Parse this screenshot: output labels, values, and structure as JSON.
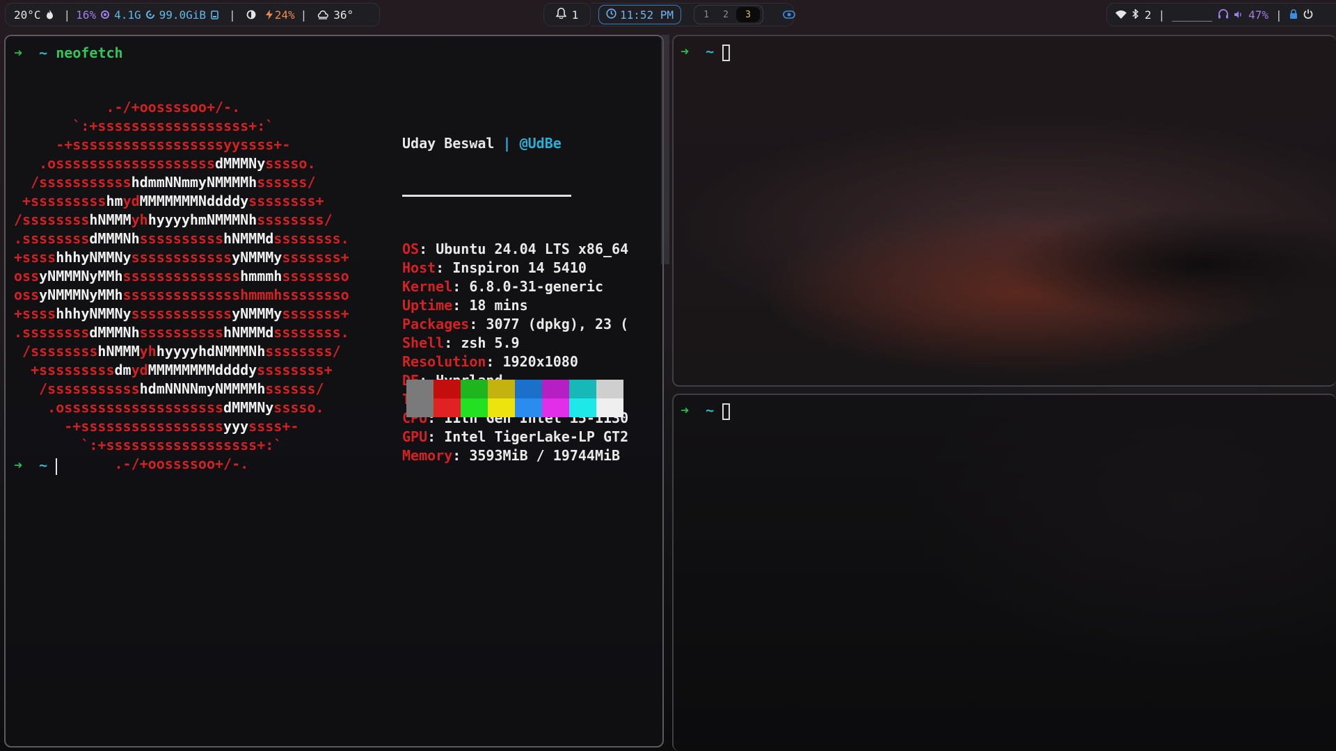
{
  "topbar": {
    "temperature": "20°C",
    "cpu": "16%",
    "memory": "4.1G",
    "disk": "99.0GiB",
    "brightness": "24%",
    "weather_temp": "36°",
    "notifications": "1",
    "clock": "11:52 PM",
    "workspaces": [
      "1",
      "2",
      "3"
    ],
    "active_workspace": "3",
    "bluetooth_count": "2",
    "media": "______",
    "volume": "47%"
  },
  "left_terminal": {
    "prompt_arrow": "➜",
    "prompt_dir": "~",
    "command": "neofetch",
    "logo_lines": [
      [
        [
          "r",
          "           .-/+oossssoo+/-."
        ]
      ],
      [
        [
          "r",
          "       `:+ssssssssssssssssss+:`"
        ]
      ],
      [
        [
          "r",
          "     -+ssssssssssssssssssyyssss+-"
        ]
      ],
      [
        [
          "r",
          "   .osssssssssssssssssss"
        ],
        [
          "w",
          "dMMMNy"
        ],
        [
          "r",
          "sssso."
        ]
      ],
      [
        [
          "r",
          "  /sssssssssss"
        ],
        [
          "w",
          "hdmmNNmmyNMMMMh"
        ],
        [
          "r",
          "ssssss/"
        ]
      ],
      [
        [
          "r",
          " +sssssssss"
        ],
        [
          "w",
          "hm"
        ],
        [
          "r",
          "yd"
        ],
        [
          "w",
          "MMMMMMMNddddy"
        ],
        [
          "r",
          "ssssssss+"
        ]
      ],
      [
        [
          "r",
          "/ssssssss"
        ],
        [
          "w",
          "hNMMM"
        ],
        [
          "r",
          "yh"
        ],
        [
          "w",
          "hyyyyhmNMMMNh"
        ],
        [
          "r",
          "ssssssss/"
        ]
      ],
      [
        [
          "r",
          ".ssssssss"
        ],
        [
          "w",
          "dMMMNh"
        ],
        [
          "r",
          "ssssssssss"
        ],
        [
          "w",
          "hNMMMd"
        ],
        [
          "r",
          "ssssssss."
        ]
      ],
      [
        [
          "r",
          "+ssss"
        ],
        [
          "w",
          "hhhyNMMNy"
        ],
        [
          "r",
          "ssssssssssss"
        ],
        [
          "w",
          "yNMMMy"
        ],
        [
          "r",
          "sssssss+"
        ]
      ],
      [
        [
          "r",
          "oss"
        ],
        [
          "w",
          "yNMMMNyMMh"
        ],
        [
          "r",
          "ssssssssssssss"
        ],
        [
          "w",
          "hmmmh"
        ],
        [
          "r",
          "ssssssso"
        ]
      ],
      [
        [
          "r",
          "oss"
        ],
        [
          "w",
          "yNMMMNyMMh"
        ],
        [
          "r",
          "sssssssssssssshmmmhssssssso"
        ]
      ],
      [
        [
          "r",
          "+ssss"
        ],
        [
          "w",
          "hhhyNMMNy"
        ],
        [
          "r",
          "ssssssssssss"
        ],
        [
          "w",
          "yNMMMy"
        ],
        [
          "r",
          "sssssss+"
        ]
      ],
      [
        [
          "r",
          ".ssssssss"
        ],
        [
          "w",
          "dMMMNh"
        ],
        [
          "r",
          "ssssssssss"
        ],
        [
          "w",
          "hNMMMd"
        ],
        [
          "r",
          "ssssssss."
        ]
      ],
      [
        [
          "r",
          " /ssssssss"
        ],
        [
          "w",
          "hNMMM"
        ],
        [
          "r",
          "yh"
        ],
        [
          "w",
          "hyyyyhdNMMMNh"
        ],
        [
          "r",
          "ssssssss/"
        ]
      ],
      [
        [
          "r",
          "  +sssssssss"
        ],
        [
          "w",
          "dm"
        ],
        [
          "r",
          "yd"
        ],
        [
          "w",
          "MMMMMMMMddddy"
        ],
        [
          "r",
          "ssssssss+"
        ]
      ],
      [
        [
          "r",
          "   /sssssssssss"
        ],
        [
          "w",
          "hdmNNNNmyNMMMMh"
        ],
        [
          "r",
          "ssssss/"
        ]
      ],
      [
        [
          "r",
          "    .osssssssssssssssssss"
        ],
        [
          "w",
          "dMMMNy"
        ],
        [
          "r",
          "sssso."
        ]
      ],
      [
        [
          "r",
          "      -+sssssssssssssssss"
        ],
        [
          "w",
          "yyy"
        ],
        [
          "r",
          "ssss+-"
        ]
      ],
      [
        [
          "r",
          "        `:+ssssssssssssssssss+:`"
        ]
      ],
      [
        [
          "r",
          "            .-/+oossssoo+/-."
        ]
      ]
    ],
    "user": "Uday Beswal",
    "separator": "|",
    "handle": "@UdBe",
    "info": [
      {
        "key": "OS",
        "value": "Ubuntu 24.04 LTS x86_64"
      },
      {
        "key": "Host",
        "value": "Inspiron 14 5410"
      },
      {
        "key": "Kernel",
        "value": "6.8.0-31-generic"
      },
      {
        "key": "Uptime",
        "value": "18 mins"
      },
      {
        "key": "Packages",
        "value": "3077 (dpkg), 23 ("
      },
      {
        "key": "Shell",
        "value": "zsh 5.9"
      },
      {
        "key": "Resolution",
        "value": "1920x1080"
      },
      {
        "key": "DE",
        "value": "Hyprland"
      },
      {
        "key": "Terminal",
        "value": "kitty"
      },
      {
        "key": "CPU",
        "value": "11th Gen Intel i5-1130"
      },
      {
        "key": "GPU",
        "value": "Intel TigerLake-LP GT2"
      },
      {
        "key": "Memory",
        "value": "3593MiB / 19744MiB"
      }
    ],
    "palette_top": [
      "#7a7a7a",
      "#c40e0e",
      "#1fb51f",
      "#c4b30e",
      "#1b70c9",
      "#b51fc4",
      "#16b8b8",
      "#cfcfcf"
    ],
    "palette_bottom": [
      "#7a7a7a",
      "#e02222",
      "#22e022",
      "#ece30f",
      "#2b8cf0",
      "#e22ee8",
      "#1ee8e8",
      "#efefef"
    ]
  },
  "right_top_terminal": {
    "prompt_arrow": "➜",
    "prompt_dir": "~"
  },
  "right_bottom_terminal": {
    "prompt_arrow": "➜",
    "prompt_dir": "~"
  }
}
